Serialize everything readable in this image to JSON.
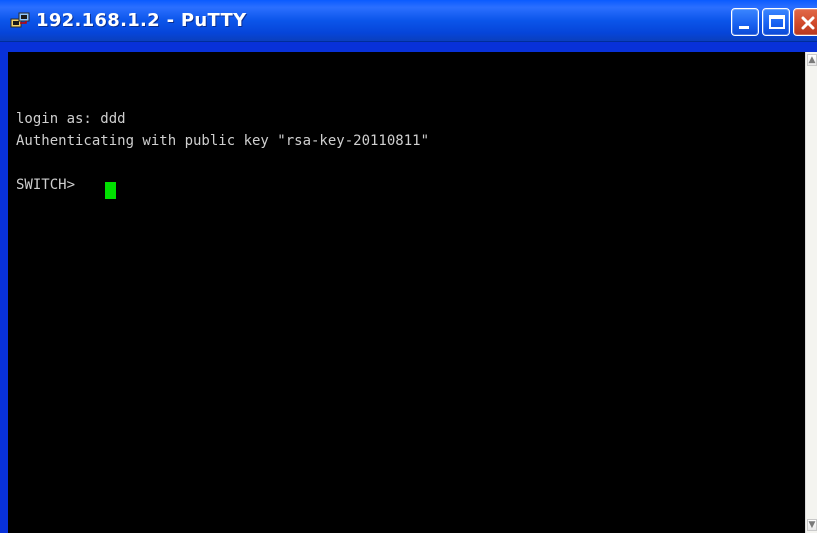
{
  "window": {
    "title": "192.168.1.2 - PuTTY",
    "accent_blue": "#0831d9",
    "terminal_bg": "#000000",
    "cursor_color": "#00e000"
  },
  "title_icon": {
    "name": "putty-icon"
  },
  "controls": {
    "minimize": {
      "icon": "minimize-icon"
    },
    "maximize": {
      "icon": "maximize-icon"
    },
    "close": {
      "icon": "close-icon"
    }
  },
  "terminal": {
    "lines": [
      "login as: ddd",
      "Authenticating with public key \"rsa-key-20110811\"",
      "SWITCH>"
    ],
    "scrollbar": {
      "up_icon": "scroll-up-arrow-icon",
      "down_icon": "scroll-down-arrow-icon"
    }
  }
}
